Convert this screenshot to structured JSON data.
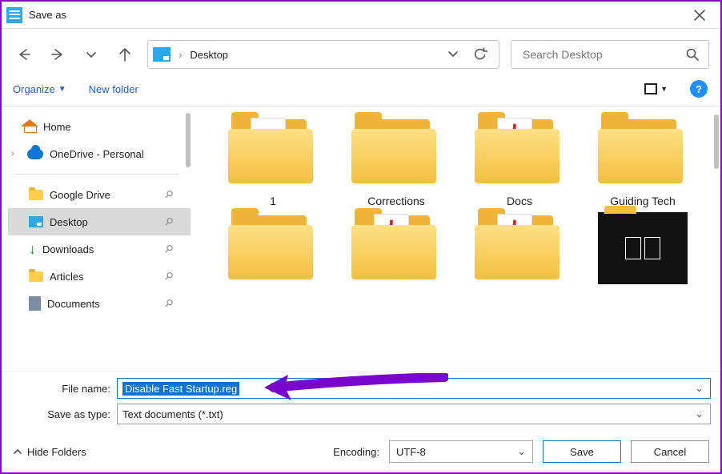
{
  "window": {
    "title": "Save as"
  },
  "address": {
    "location": "Desktop"
  },
  "search": {
    "placeholder": "Search Desktop"
  },
  "toolbar": {
    "organize": "Organize",
    "new_folder": "New folder"
  },
  "tree": {
    "home": "Home",
    "onedrive": "OneDrive - Personal",
    "items": [
      {
        "label": "Google Drive"
      },
      {
        "label": "Desktop"
      },
      {
        "label": "Downloads"
      },
      {
        "label": "Articles"
      },
      {
        "label": "Documents"
      }
    ]
  },
  "grid": {
    "items": [
      {
        "label": "1",
        "kind": "folder-pic"
      },
      {
        "label": "Corrections",
        "kind": "folder"
      },
      {
        "label": "Docs",
        "kind": "folder-pdf"
      },
      {
        "label": "Guiding Tech",
        "kind": "folder"
      },
      {
        "label": "",
        "kind": "folder"
      },
      {
        "label": "",
        "kind": "folder-pdf"
      },
      {
        "label": "",
        "kind": "folder-pdf"
      },
      {
        "label": "",
        "kind": "dark"
      }
    ]
  },
  "form": {
    "file_name_label": "File name:",
    "file_name_value": "Disable Fast Startup.reg",
    "save_type_label": "Save as type:",
    "save_type_value": "Text documents (*.txt)"
  },
  "footer": {
    "hide": "Hide Folders",
    "encoding_label": "Encoding:",
    "encoding_value": "UTF-8",
    "save": "Save",
    "cancel": "Cancel"
  },
  "help": "?"
}
